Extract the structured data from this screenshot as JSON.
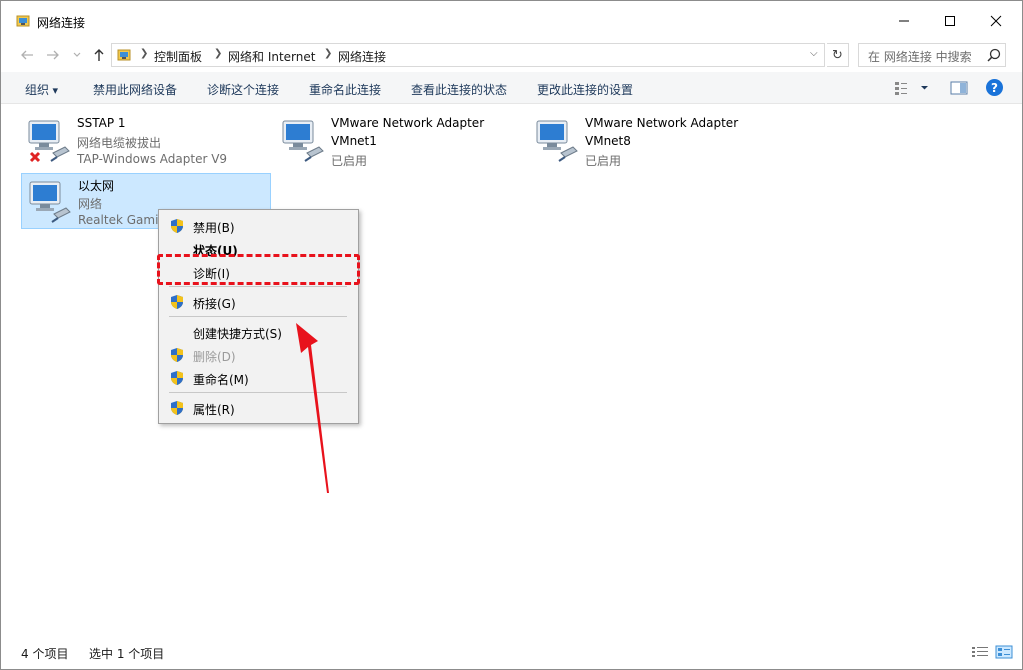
{
  "window": {
    "title": "网络连接",
    "controls": {
      "minimize": "—",
      "maximize": "☐",
      "close": "✕"
    }
  },
  "address_bar": {
    "nav_icons": [
      "back-arrow-icon",
      "forward-arrow-icon",
      "recent-dropdown-icon",
      "up-arrow-icon"
    ],
    "breadcrumb": [
      "控制面板",
      "网络和 Internet",
      "网络连接"
    ],
    "search_placeholder": "在 网络连接 中搜索"
  },
  "command_bar": {
    "organize": "组织",
    "items": [
      "禁用此网络设备",
      "诊断这个连接",
      "重命名此连接",
      "查看此连接的状态",
      "更改此连接的设置"
    ]
  },
  "connections": [
    {
      "name": "SSTAP 1",
      "status": "网络电缆被拔出",
      "device": "TAP-Windows Adapter V9",
      "state_icon": "red-x-icon"
    },
    {
      "name": "VMware Network Adapter",
      "status": "VMnet1",
      "device": "已启用"
    },
    {
      "name": "VMware Network Adapter",
      "status": "VMnet8",
      "device": "已启用"
    },
    {
      "name": "以太网",
      "status": "网络",
      "device": "Realtek Gamin",
      "selected": true
    }
  ],
  "context_menu": {
    "items": [
      {
        "label": "禁用(B)",
        "shield": true
      },
      {
        "label": "状态(U)",
        "bold": true
      },
      {
        "label": "诊断(I)",
        "highlighted": true
      },
      {
        "label": "桥接(G)",
        "shield": true
      },
      {
        "label": "创建快捷方式(S)"
      },
      {
        "label": "删除(D)",
        "shield": true,
        "disabled": true
      },
      {
        "label": "重命名(M)",
        "shield": true
      },
      {
        "label": "属性(R)",
        "shield": true
      }
    ]
  },
  "status_bar": {
    "item_count": "4 个项目",
    "selected_count": "选中 1 个项目"
  },
  "colors": {
    "selection_bg": "#cce8ff",
    "annotation_red": "#e8121c",
    "help_blue": "#1a73d9"
  }
}
